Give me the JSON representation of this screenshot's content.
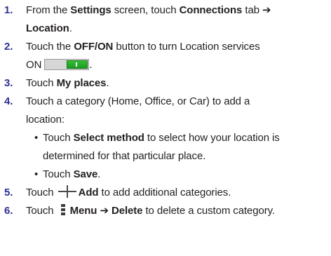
{
  "steps": [
    {
      "num": "1.",
      "parts": [
        "From the ",
        "Settings",
        " screen, touch ",
        "Connections",
        " tab ➔ ",
        "Location",
        "."
      ]
    },
    {
      "num": "2.",
      "parts": [
        "Touch the ",
        "OFF/ON",
        " button to turn Location services",
        "ON",
        "."
      ]
    },
    {
      "num": "3.",
      "parts": [
        "Touch ",
        "My places",
        "."
      ]
    },
    {
      "num": "4.",
      "parts": [
        "Touch a category (Home, Office, or Car) to add a",
        "location:"
      ]
    },
    {
      "num": "5.",
      "parts": [
        "Touch ",
        "Add",
        " to add additional categories."
      ]
    },
    {
      "num": "6.",
      "parts": [
        "Touch ",
        "Menu ➔ Delete",
        " to delete a custom category."
      ]
    }
  ],
  "bullets": [
    {
      "symbol": "•",
      "parts": [
        "Touch ",
        "Select method",
        " to select how your location is",
        "determined for that particular place."
      ]
    },
    {
      "symbol": "•",
      "parts": [
        "Touch ",
        "Save",
        "."
      ]
    }
  ],
  "icons": {
    "toggle": "on-toggle-icon",
    "plus": "plus-icon",
    "menu": "menu-icon"
  },
  "colors": {
    "number": "#2e3192",
    "toggle_on": "#22a527",
    "text": "#231f20"
  }
}
